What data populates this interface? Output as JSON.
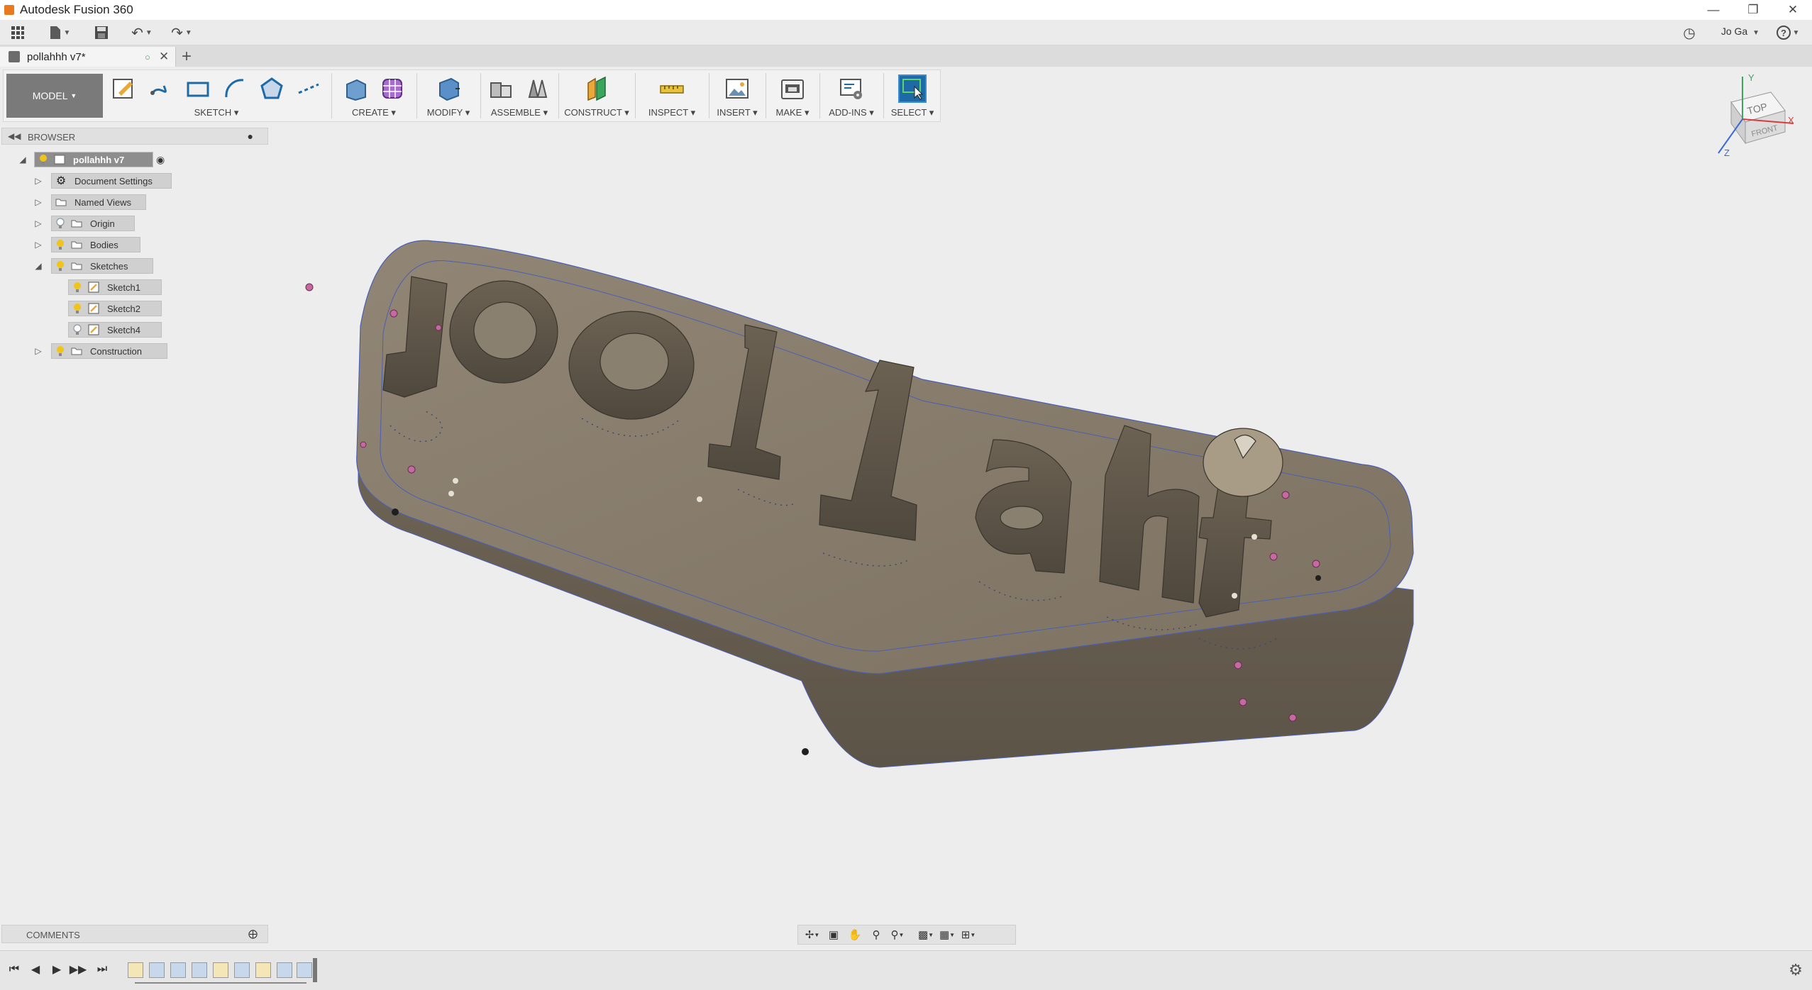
{
  "window": {
    "title": "Autodesk Fusion 360"
  },
  "quick_access": {
    "user_label": "Jo Ga"
  },
  "document_tab": {
    "name": "pollahhh v7*"
  },
  "ribbon": {
    "workspace": "MODEL",
    "groups": [
      {
        "label": "SKETCH"
      },
      {
        "label": "CREATE"
      },
      {
        "label": "MODIFY"
      },
      {
        "label": "ASSEMBLE"
      },
      {
        "label": "CONSTRUCT"
      },
      {
        "label": "INSPECT"
      },
      {
        "label": "INSERT"
      },
      {
        "label": "MAKE"
      },
      {
        "label": "ADD-INS"
      },
      {
        "label": "SELECT"
      }
    ]
  },
  "browser": {
    "title": "BROWSER",
    "root": "pollahhh v7",
    "items": [
      {
        "label": "Document Settings"
      },
      {
        "label": "Named Views"
      },
      {
        "label": "Origin"
      },
      {
        "label": "Bodies"
      },
      {
        "label": "Sketches"
      },
      {
        "label": "Sketch1"
      },
      {
        "label": "Sketch2"
      },
      {
        "label": "Sketch4"
      },
      {
        "label": "Construction"
      }
    ]
  },
  "model": {
    "engraved_text": "pollahti"
  },
  "viewcube": {
    "top": "TOP",
    "front": "FRONT",
    "axis_x": "X",
    "axis_y": "Y",
    "axis_z": "Z"
  },
  "comments": {
    "title": "COMMENTS"
  },
  "colors": {
    "body": "#7b7163",
    "body_top": "#8a8070",
    "sketch_line": "#4b5fb3",
    "select_accent": "#1e6aa6"
  }
}
